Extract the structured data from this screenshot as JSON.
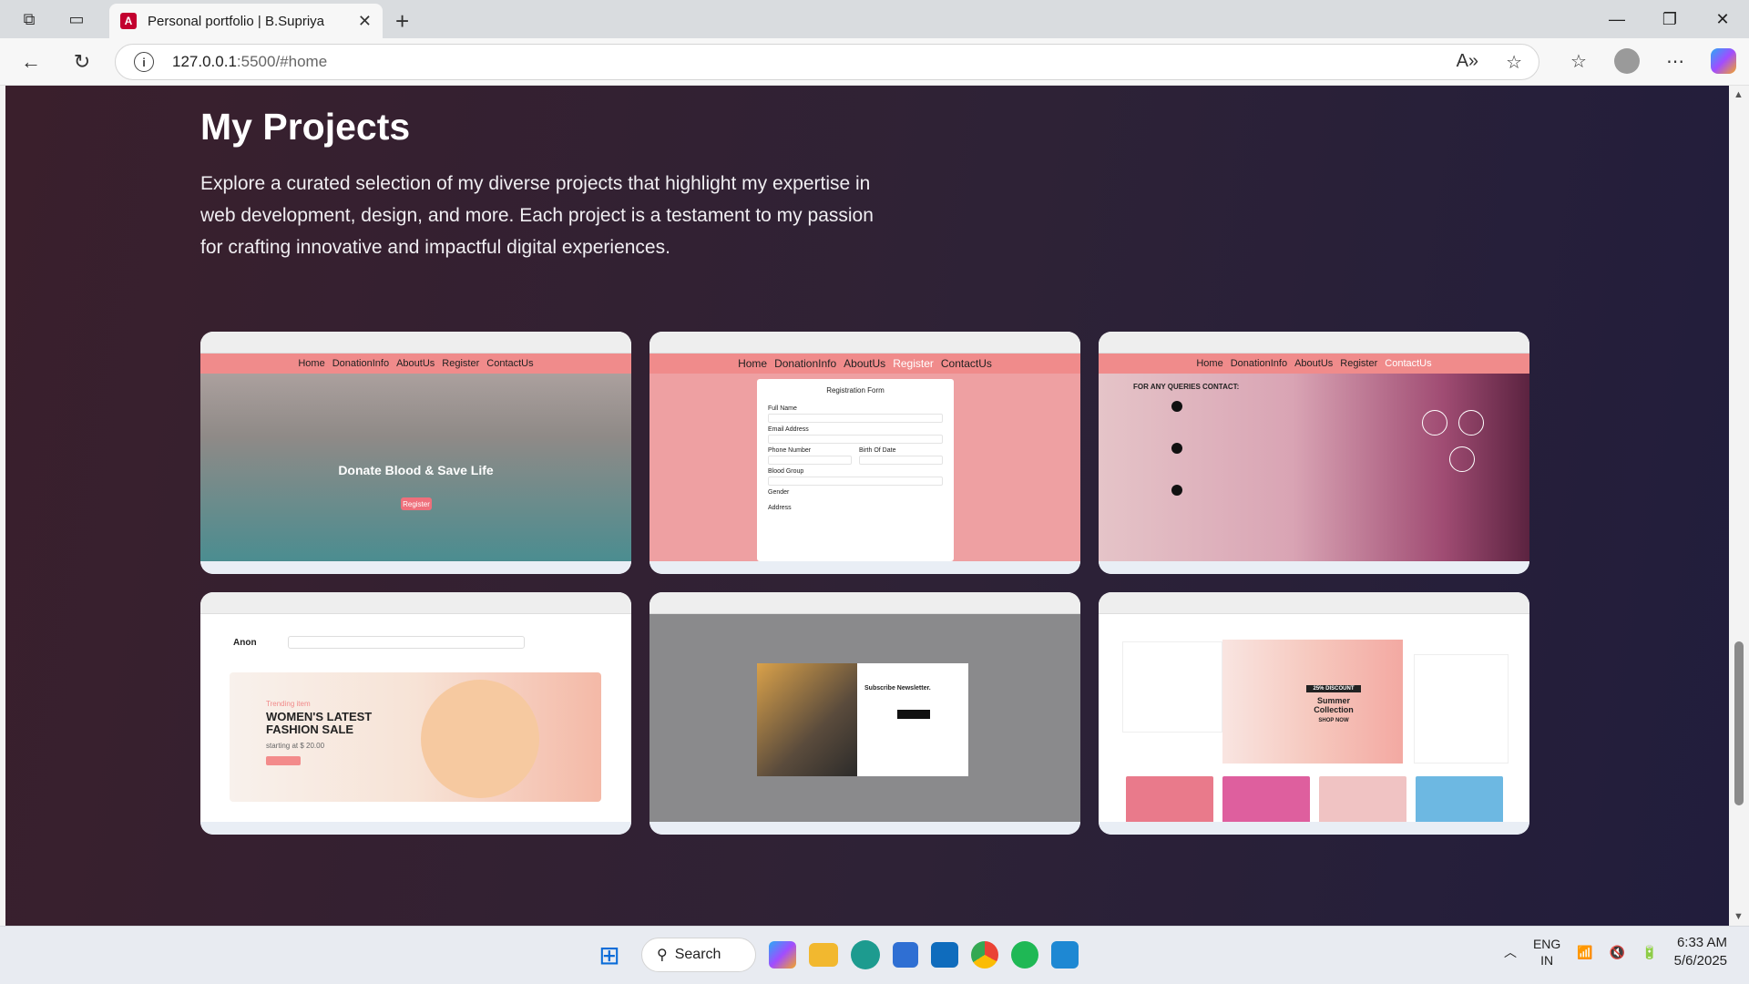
{
  "browser": {
    "tab_title": "Personal portfolio | B.Supriya",
    "url_host": "127.0.0.1",
    "url_path": ":5500/#home"
  },
  "page": {
    "heading": "My Projects",
    "description": "Explore a curated selection of my diverse projects that highlight my expertise in web development, design, and more. Each project is a testament to my passion for crafting innovative and impactful digital experiences."
  },
  "projects": [
    {
      "nav": [
        "Home",
        "DonationInfo",
        "AboutUs",
        "Register",
        "ContactUs"
      ],
      "hero": "Donate Blood & Save Life",
      "button": "Register"
    },
    {
      "nav": [
        "Home",
        "DonationInfo",
        "AboutUs",
        "Register",
        "ContactUs"
      ],
      "form_title": "Registration Form",
      "fields": [
        "Full Name",
        "Email Address",
        "Phone Number",
        "Birth Of Date",
        "Blood Group",
        "Gender",
        "Address"
      ]
    },
    {
      "nav": [
        "Home",
        "DonationInfo",
        "AboutUs",
        "Register",
        "ContactUs"
      ],
      "queries": "FOR ANY QUERIES CONTACT:"
    },
    {
      "logo": "Anon",
      "trending": "Trending item",
      "title": "WOMEN'S LATEST FASHION SALE",
      "start": "starting at $ 20.00"
    },
    {
      "modal_title": "Subscribe Newsletter."
    },
    {
      "badge": "25% DISCOUNT",
      "title": "Summer Collection",
      "cta": "SHOP NOW"
    }
  ],
  "taskbar": {
    "search_label": "Search",
    "lang": "ENG",
    "region": "IN",
    "time": "6:33 AM",
    "date": "5/6/2025"
  }
}
